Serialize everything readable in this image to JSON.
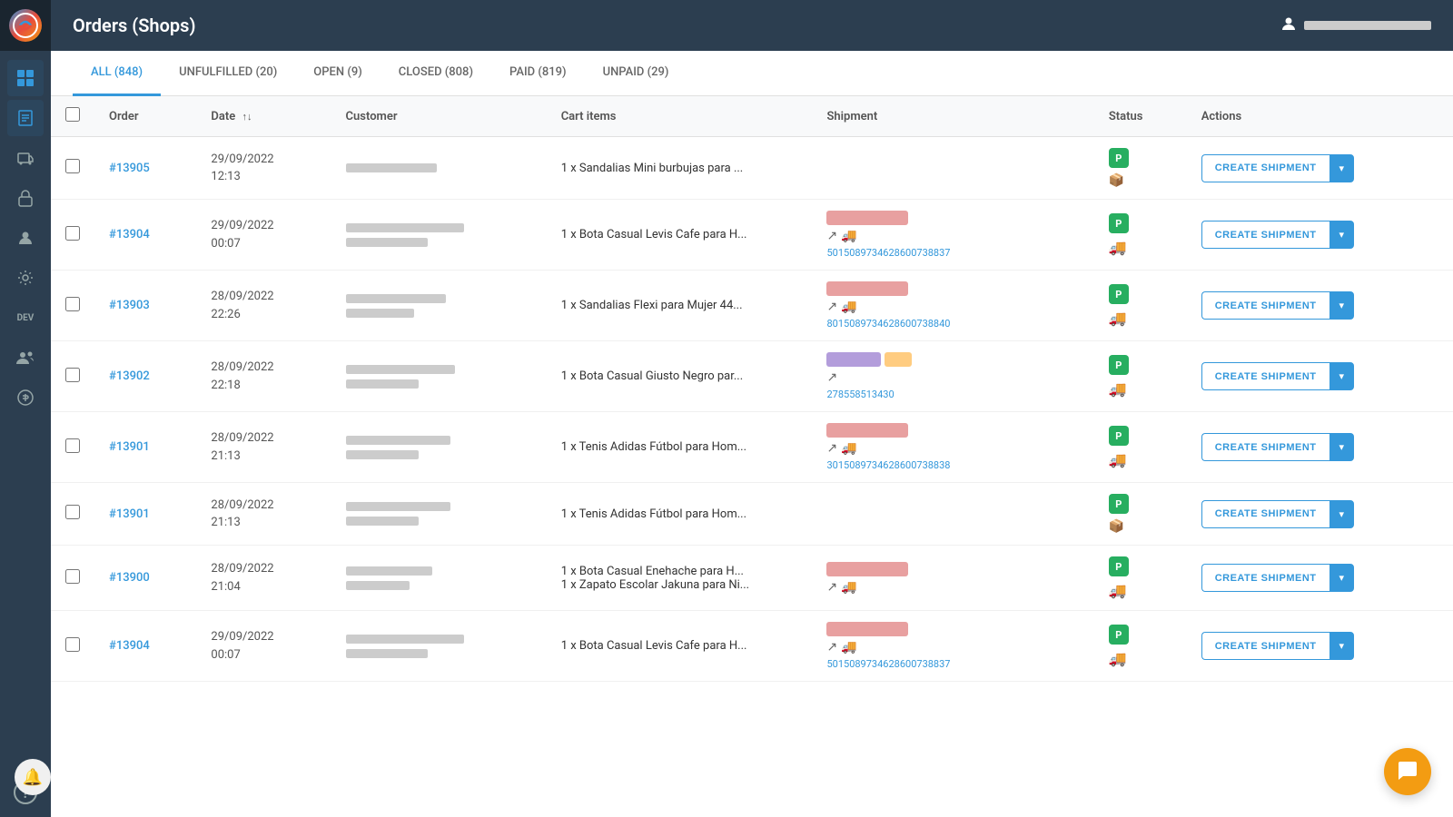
{
  "app": {
    "title": "Orders (Shops)"
  },
  "topbar": {
    "title": "Orders (Shops)",
    "user_label": "User Account"
  },
  "sidebar": {
    "icons": [
      {
        "name": "dashboard-icon",
        "symbol": "⊞",
        "active": false
      },
      {
        "name": "orders-icon",
        "symbol": "📋",
        "active": true
      },
      {
        "name": "shipments-icon",
        "symbol": "🚚",
        "active": false
      },
      {
        "name": "lock-icon",
        "symbol": "🔒",
        "active": false
      },
      {
        "name": "contacts-icon",
        "symbol": "👤",
        "active": false
      },
      {
        "name": "settings-icon",
        "symbol": "⚙",
        "active": false
      },
      {
        "name": "dev-icon",
        "symbol": "DEV",
        "active": false
      },
      {
        "name": "team-icon",
        "symbol": "👥",
        "active": false
      },
      {
        "name": "billing-icon",
        "symbol": "💰",
        "active": false
      },
      {
        "name": "help-icon",
        "symbol": "?",
        "active": false
      }
    ]
  },
  "tabs": [
    {
      "label": "ALL (848)",
      "active": true
    },
    {
      "label": "UNFULFILLED (20)",
      "active": false
    },
    {
      "label": "OPEN (9)",
      "active": false
    },
    {
      "label": "CLOSED (808)",
      "active": false
    },
    {
      "label": "PAID (819)",
      "active": false
    },
    {
      "label": "UNPAID (29)",
      "active": false
    }
  ],
  "table": {
    "headers": [
      "",
      "Order",
      "Date",
      "Customer",
      "Cart items",
      "Shipment",
      "Status",
      "Actions"
    ],
    "rows": [
      {
        "id": "row-13905",
        "order": "#13905",
        "date_line1": "29/09/2022",
        "date_line2": "12:13",
        "cart_items": "1 x Sandalias Mini burbujas para ...",
        "has_tracking": false,
        "tracking_number": "",
        "carrier_color": "red",
        "action_label": "CREATE SHIPMENT"
      },
      {
        "id": "row-13904",
        "order": "#13904",
        "date_line1": "29/09/2022",
        "date_line2": "00:07",
        "cart_items": "1 x Bota Casual Levis Cafe para H...",
        "has_tracking": true,
        "tracking_number": "501508973462860073883​7",
        "carrier_color": "red",
        "action_label": "CREATE SHIPMENT"
      },
      {
        "id": "row-13903",
        "order": "#13903",
        "date_line1": "28/09/2022",
        "date_line2": "22:26",
        "cart_items": "1 x Sandalias Flexi para Mujer 44...",
        "has_tracking": true,
        "tracking_number": "801508973462860073884​0",
        "carrier_color": "red",
        "action_label": "CREATE SHIPMENT"
      },
      {
        "id": "row-13902",
        "order": "#13902",
        "date_line1": "28/09/2022",
        "date_line2": "22:18",
        "cart_items": "1 x Bota Casual Giusto Negro par...",
        "has_tracking": true,
        "tracking_number": "278558513430",
        "carrier_color": "purple-orange",
        "action_label": "CREATE SHIPMENT"
      },
      {
        "id": "row-13901a",
        "order": "#13901",
        "date_line1": "28/09/2022",
        "date_line2": "21:13",
        "cart_items": "1 x Tenis Adidas Fútbol para Hom...",
        "has_tracking": true,
        "tracking_number": "301508973462860073883​8",
        "carrier_color": "red",
        "action_label": "CREATE SHIPMENT"
      },
      {
        "id": "row-13901b",
        "order": "#13901",
        "date_line1": "28/09/2022",
        "date_line2": "21:13",
        "cart_items": "1 x Tenis Adidas Fútbol para Hom...",
        "has_tracking": false,
        "tracking_number": "",
        "carrier_color": "none",
        "action_label": "CREATE SHIPMENT"
      },
      {
        "id": "row-13900",
        "order": "#13900",
        "date_line1": "28/09/2022",
        "date_line2": "21:04",
        "cart_items": "1 x Bota Casual Enehache para H...\n1 x Zapato Escolar Jakuna para Ni...",
        "has_tracking": true,
        "tracking_number": "",
        "carrier_color": "red",
        "action_label": "CREATE SHIPMENT"
      },
      {
        "id": "row-13904b",
        "order": "#13904",
        "date_line1": "29/09/2022",
        "date_line2": "00:07",
        "cart_items": "1 x Bota Casual Levis Cafe para H...",
        "has_tracking": true,
        "tracking_number": "501508973462860073883​7",
        "carrier_color": "red",
        "action_label": "CREATE SHIPMENT"
      }
    ],
    "create_shipment_label": "CREATE SHIPMENT",
    "dropdown_arrow": "▾"
  },
  "chat": {
    "icon": "💬"
  },
  "notification": {
    "icon": "🔔"
  }
}
